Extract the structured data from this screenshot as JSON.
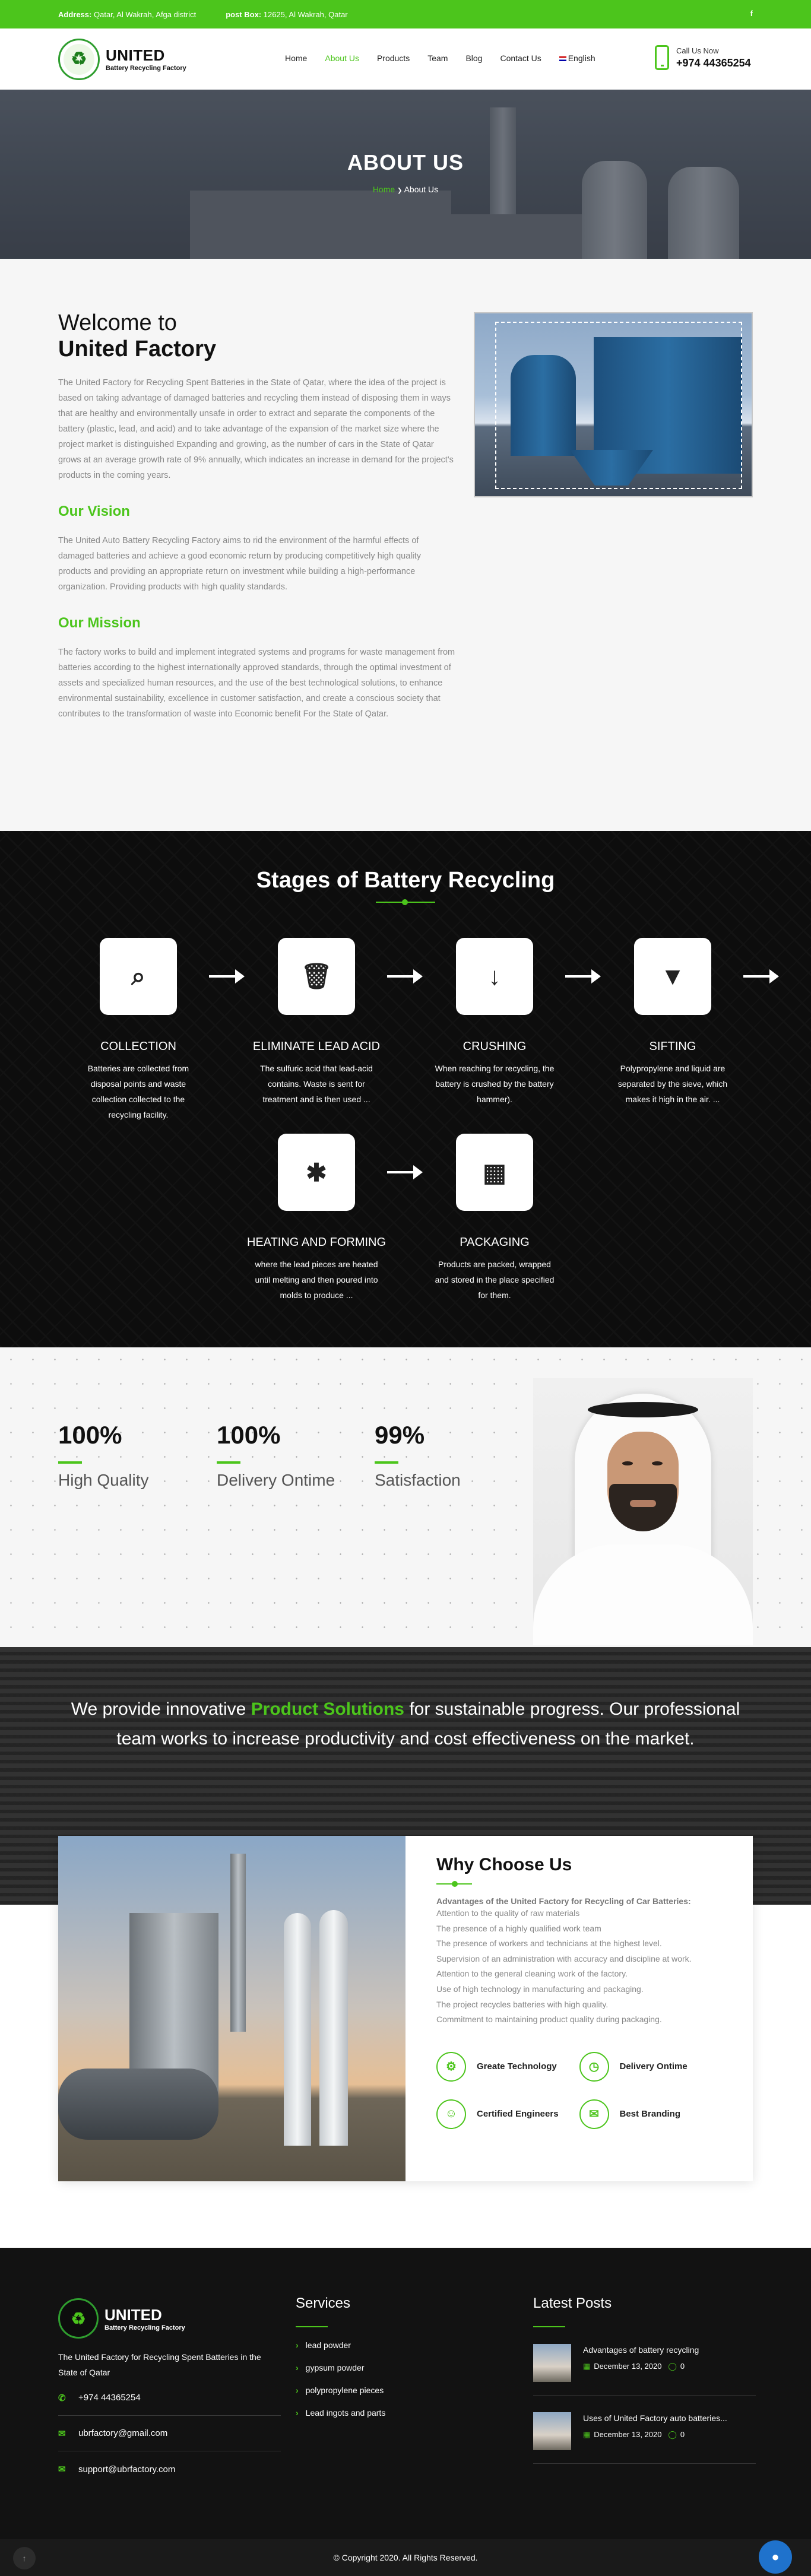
{
  "topbar": {
    "address_label": "Address:",
    "address": "Qatar, Al Wakrah, Afga district",
    "pobox_label": "post Box:",
    "pobox": "12625, Al Wakrah, Qatar",
    "social_icon": "facebook-icon",
    "social_text": "f"
  },
  "header": {
    "brand": "UNITED",
    "brand_sub": "Battery Recycling Factory",
    "nav": [
      "Home",
      "About Us",
      "Products",
      "Team",
      "Blog",
      "Contact Us",
      "English"
    ],
    "active_nav": "About Us",
    "call_label": "Call Us Now",
    "call_number": "+974 44365254"
  },
  "hero": {
    "title": "ABOUT US",
    "crumb_home": "Home",
    "crumb_sep": "❯",
    "crumb_current": "About Us"
  },
  "welcome": {
    "title_line1": "Welcome to",
    "title_line2": "United Factory",
    "intro": "The United Factory for Recycling Spent Batteries in the State of Qatar, where the idea of the project is based on taking advantage of damaged batteries and recycling them instead of disposing them in ways that are healthy and environmentally unsafe in order to extract and separate the components of the battery (plastic, lead, and acid) and to take advantage of the expansion of the market size where the project market is distinguished Expanding and growing, as the number of cars in the State of Qatar grows at an average growth rate of 9% annually, which indicates an increase in demand for the project's products in the coming years.",
    "vision_title": "Our Vision",
    "vision": "The United Auto Battery Recycling Factory aims to rid the environment of the harmful effects of damaged batteries and achieve a good economic return by producing competitively high quality products and providing an appropriate return on investment while building a high-performance organization. Providing products with high quality standards.",
    "mission_title": "Our Mission",
    "mission": "The factory works to build and implement integrated systems and programs for waste management from batteries according to the highest internationally approved standards, through the optimal investment of assets and specialized human resources, and the use of the best technological solutions, to enhance environmental sustainability, excellence in customer satisfaction, and create a conscious society that contributes to the transformation of waste into Economic benefit For the State of Qatar."
  },
  "stages": {
    "title": "Stages of Battery Recycling",
    "items": [
      {
        "icon": "search-icon",
        "glyph": "⌕",
        "title": "COLLECTION",
        "desc": "Batteries are collected from disposal points and waste collection collected to the recycling facility."
      },
      {
        "icon": "trash-icon",
        "glyph": "🗑",
        "title": "ELIMINATE LEAD ACID",
        "desc": "The sulfuric acid that lead-acid contains. Waste is sent for treatment and is then used ..."
      },
      {
        "icon": "arrow-down-icon",
        "glyph": "↓",
        "title": "CRUSHING",
        "desc": "When reaching for recycling, the battery is crushed by the battery hammer)."
      },
      {
        "icon": "filter-icon",
        "glyph": "▼",
        "title": "SIFTING",
        "desc": "Polypropylene and liquid are separated by the sieve, which makes it high in the air. ..."
      },
      {
        "icon": "asterisk-icon",
        "glyph": "✱",
        "title": "HEATING AND FORMING",
        "desc": "where the lead pieces are heated until melting and then poured into molds to produce ..."
      },
      {
        "icon": "qrcode-icon",
        "glyph": "▦",
        "title": "PACKAGING",
        "desc": "Products are packed, wrapped and stored in the place specified for them."
      }
    ]
  },
  "stats": {
    "items": [
      {
        "value": "100%",
        "label": "High Quality"
      },
      {
        "value": "100%",
        "label": "Delivery Ontime"
      },
      {
        "value": "99%",
        "label": "Satisfaction"
      }
    ]
  },
  "provide": {
    "before": "We provide innovative ",
    "highlight": "Product Solutions",
    "after": " for sustainable progress. Our professional team works to increase productivity and cost effectiveness on the market."
  },
  "why": {
    "title": "Why Choose Us",
    "lead": "Advantages of the United Factory for Recycling of Car Batteries:",
    "points": [
      "Attention to the quality of raw materials",
      "The presence of a highly qualified work team",
      "The presence of workers and technicians at the highest level.",
      "Supervision of an administration with accuracy and discipline at work.",
      "Attention to the general cleaning work of the factory.",
      "Use of high technology in manufacturing and packaging.",
      "The project recycles batteries with high quality.",
      "Commitment to maintaining product quality during packaging."
    ],
    "features": [
      {
        "icon": "technology-icon",
        "glyph": "⚙",
        "label": "Greate Technology"
      },
      {
        "icon": "clock-icon",
        "glyph": "◷",
        "label": "Delivery Ontime"
      },
      {
        "icon": "engineer-icon",
        "glyph": "☺",
        "label": "Certified Engineers"
      },
      {
        "icon": "megaphone-icon",
        "glyph": "✉",
        "label": "Best Branding"
      }
    ]
  },
  "footer": {
    "brand": "UNITED",
    "brand_sub": "Battery Recycling Factory",
    "about": "The United Factory for Recycling Spent Batteries in the State of Qatar",
    "phone": "+974 44365254",
    "email1": "ubrfactory@gmail.com",
    "email2": "support@ubrfactory.com",
    "services_title": "Services",
    "services": [
      "lead powder",
      "gypsum powder",
      "polypropylene pieces",
      "Lead ingots and parts"
    ],
    "posts_title": "Latest Posts",
    "posts": [
      {
        "title": "Advantages of battery recycling",
        "date": "December 13, 2020",
        "comments": "0"
      },
      {
        "title": "Uses of United Factory auto batteries...",
        "date": "December 13, 2020",
        "comments": "0"
      }
    ],
    "copyright": "© Copyright 2020. All Rights Reserved."
  },
  "colors": {
    "accent": "#4cc51c",
    "dark": "#121212",
    "chat": "#1f72cc"
  }
}
